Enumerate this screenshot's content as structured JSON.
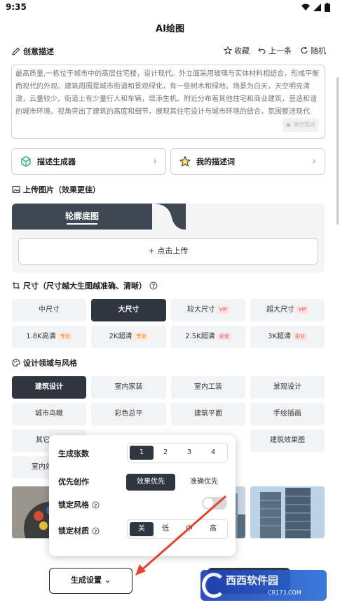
{
  "status": {
    "time": "9:35"
  },
  "page": {
    "title": "AI绘图"
  },
  "description": {
    "heading": "创意描述",
    "actions": {
      "favorite": "收藏",
      "previous": "上一条",
      "random": "随机"
    },
    "text": "最高质量,一栋位于城市中的高层住宅楼，设计现代。外立面采用玻璃与实体材料相结合，形成平衡而现代的外观。建筑周围是城市街道和景观绿化，有一些树木和绿地。场景为白天，天空明亮清澈，云量较少。街道上有少量行人和车辆，增添生机。附近分布着其他住宅和商业建筑，营造和谐的城市环境。视角突出了建筑的高度和细节，展现其住宅设计与城市环境的结合，氛围整洁现代",
    "clear": "清空描述"
  },
  "cards": {
    "generator": "描述生成器",
    "my_prompts": "我的描述词"
  },
  "upload": {
    "heading": "上传图片（效果更佳）",
    "tab": "轮廓底图",
    "button": "+ 点击上传"
  },
  "size": {
    "heading": "尺寸（尺寸越大生图越准确、清晰）",
    "options": [
      {
        "label": "中尺寸",
        "tag": ""
      },
      {
        "label": "大尺寸",
        "tag": ""
      },
      {
        "label": "较大尺寸",
        "tag": "VIP"
      },
      {
        "label": "超大尺寸",
        "tag": "VIP"
      }
    ],
    "resolutions": [
      {
        "label": "1.8K高清",
        "tag": "专业"
      },
      {
        "label": "2K超清",
        "tag": "专业"
      },
      {
        "label": "2.5K超清",
        "tag": "企业"
      },
      {
        "label": "3K超清",
        "tag": "企业"
      }
    ]
  },
  "style": {
    "heading": "设计领域与风格",
    "row1": [
      "建筑设计",
      "室内家装",
      "室内工装",
      "景观设计"
    ],
    "row2": [
      "城市鸟瞰",
      "彩色总平",
      "建筑平面",
      "手绘插画"
    ],
    "row3_left": "其它",
    "row3_right": "建筑效果图",
    "row4_left": "室内效"
  },
  "settings": {
    "count_label": "生成张数",
    "counts": [
      "1",
      "2",
      "3",
      "4"
    ],
    "priority_label": "优先创作",
    "priority_options": [
      "效果优先",
      "准确优先"
    ],
    "lock_style_label": "锁定风格",
    "lock_material_label": "锁定材质",
    "material_options": [
      "关",
      "低",
      "中",
      "高"
    ]
  },
  "bottom": {
    "settings_button": "生成设置"
  },
  "watermark": {
    "brand": "西西软件园",
    "url": "CR173.COM"
  },
  "colors": {
    "accent_dark": "#2f3640",
    "arrow": "#e4442e",
    "vip": "#e0454a"
  }
}
